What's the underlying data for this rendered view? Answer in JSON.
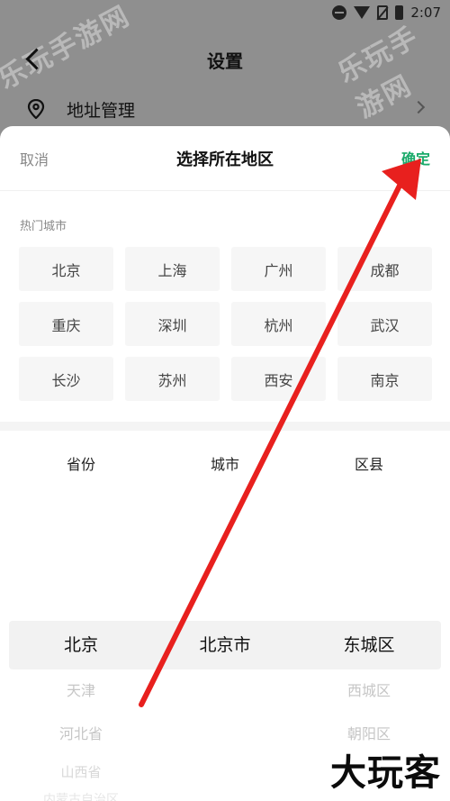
{
  "status_bar": {
    "time": "2:07"
  },
  "watermark": {
    "text": "乐玩手游网"
  },
  "background_page": {
    "title": "设置",
    "address_row_label": "地址管理"
  },
  "sheet": {
    "cancel_label": "取消",
    "title": "选择所在地区",
    "confirm_label": "确定",
    "hot_cities_label": "热门城市",
    "hot_cities": [
      "北京",
      "上海",
      "广州",
      "成都",
      "重庆",
      "深圳",
      "杭州",
      "武汉",
      "长沙",
      "苏州",
      "西安",
      "南京"
    ],
    "column_headers": {
      "province": "省份",
      "city": "城市",
      "district": "区县"
    },
    "picker": {
      "province": {
        "selected": "北京",
        "options": [
          "天津",
          "河北省",
          "山西省",
          "内蒙古自治区"
        ]
      },
      "city": {
        "selected": "北京市",
        "options": []
      },
      "district": {
        "selected": "东城区",
        "options": [
          "西城区",
          "朝阳区"
        ]
      }
    }
  },
  "brand_logo": "大玩客",
  "colors": {
    "confirm": "#1aaa6a",
    "annotation_arrow": "#e8201e",
    "overlay": "#8f8f8f"
  }
}
